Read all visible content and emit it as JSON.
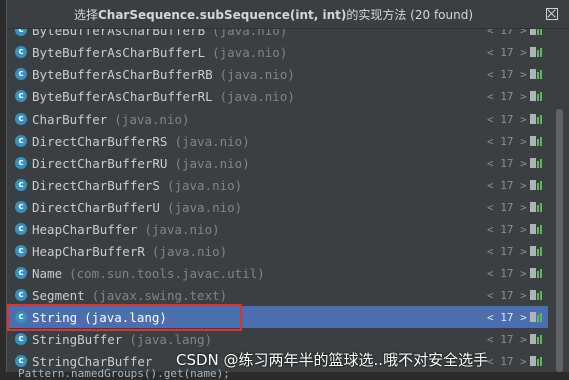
{
  "popup": {
    "title_prefix": "选择",
    "title_strong": "CharSequence.subSequence(int, int)",
    "title_suffix": "的实现方法 (20 found)"
  },
  "items": [
    {
      "name": "ByteBufferAsCharBufferB",
      "pkg": "(java.nio)",
      "ver": "< 17 >",
      "icon": "c-class-icon"
    },
    {
      "name": "ByteBufferAsCharBufferL",
      "pkg": "(java.nio)",
      "ver": "< 17 >",
      "icon": "c-class-icon"
    },
    {
      "name": "ByteBufferAsCharBufferRB",
      "pkg": "(java.nio)",
      "ver": "< 17 >",
      "icon": "c-class-icon"
    },
    {
      "name": "ByteBufferAsCharBufferRL",
      "pkg": "(java.nio)",
      "ver": "< 17 >",
      "icon": "c-class-icon"
    },
    {
      "name": "CharBuffer",
      "pkg": "(java.nio)",
      "ver": "< 17 >",
      "icon": "c-class-icon"
    },
    {
      "name": "DirectCharBufferRS",
      "pkg": "(java.nio)",
      "ver": "< 17 >",
      "icon": "c-class-icon"
    },
    {
      "name": "DirectCharBufferRU",
      "pkg": "(java.nio)",
      "ver": "< 17 >",
      "icon": "c-class-icon"
    },
    {
      "name": "DirectCharBufferS",
      "pkg": "(java.nio)",
      "ver": "< 17 >",
      "icon": "c-class-icon"
    },
    {
      "name": "DirectCharBufferU",
      "pkg": "(java.nio)",
      "ver": "< 17 >",
      "icon": "c-class-icon"
    },
    {
      "name": "HeapCharBuffer",
      "pkg": "(java.nio)",
      "ver": "< 17 >",
      "icon": "c-class-icon"
    },
    {
      "name": "HeapCharBufferR",
      "pkg": "(java.nio)",
      "ver": "< 17 >",
      "icon": "c-class-icon"
    },
    {
      "name": "Name",
      "pkg": "(com.sun.tools.javac.util)",
      "ver": "< 17 >",
      "icon": "c-class-icon"
    },
    {
      "name": "Segment",
      "pkg": "(javax.swing.text)",
      "ver": "< 17 >",
      "icon": "c-class-icon"
    },
    {
      "name": "String",
      "pkg": "(java.lang)",
      "ver": "< 17 >",
      "icon": "c-class-icon",
      "selected": true
    },
    {
      "name": "StringBuffer",
      "pkg": "(java.lang)",
      "ver": "< 17 >",
      "icon": "c-class-icon"
    },
    {
      "name": "StringCharBuffer",
      "pkg": "",
      "ver": "< 17 >",
      "icon": "c-class-icon"
    }
  ],
  "editor": {
    "code_line": "Pattern.namedGroups().get(name);"
  },
  "watermark": "CSDN @练习两年半的篮球选..哦不对安全选手",
  "colors": {
    "selection": "#4b6eaf",
    "highlight_box": "#e0312e",
    "class_icon": "#3592c4"
  }
}
